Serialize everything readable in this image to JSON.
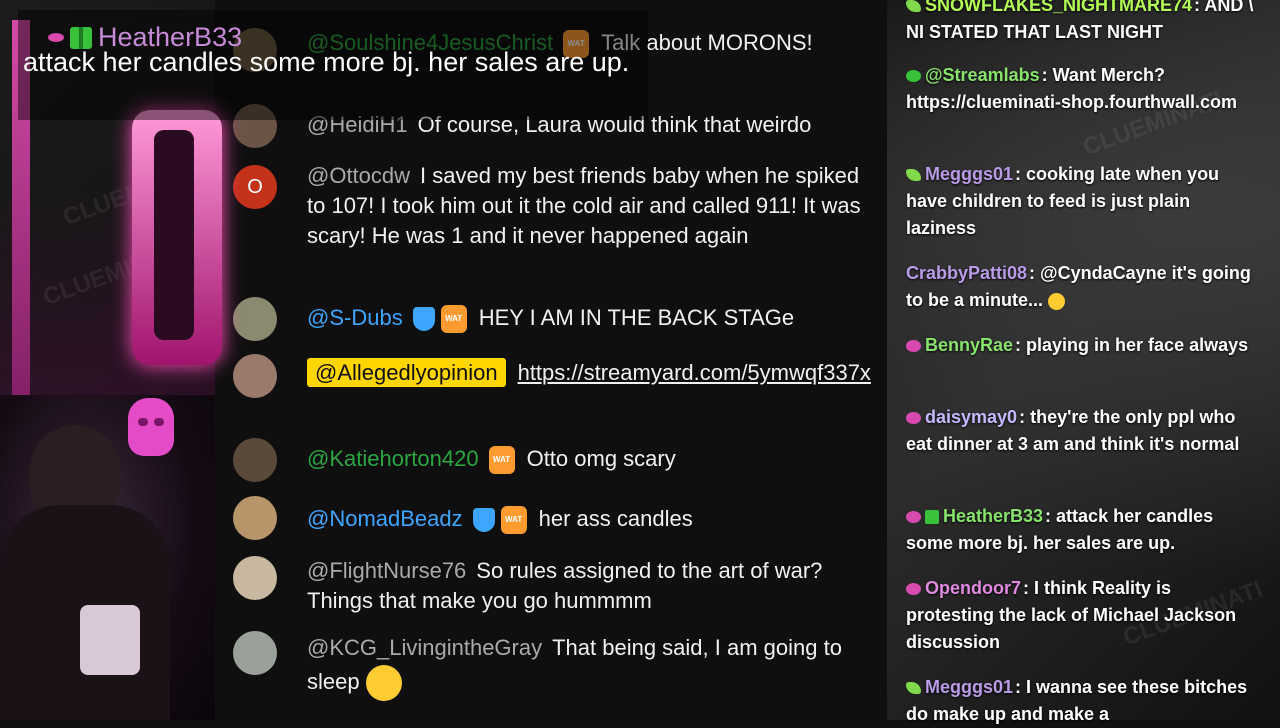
{
  "overlay": {
    "alert_user": "HeatherB33",
    "alert_message": "attack her candles some more bj. her sales are up.",
    "watermark": "CLUEMINATI"
  },
  "youtube_chat": {
    "messages": [
      {
        "author": "@Soulshine4JesusChrist",
        "text": "Talk about MORONS!",
        "author_color": "green",
        "badge": "wat"
      },
      {
        "author": "@HeidiH1",
        "text": "Of course, Laura would think that weirdo",
        "author_color": "gray"
      },
      {
        "author": "@Ottocdw",
        "text": "I saved my best friends baby when he spiked to 107! I took him out it the cold air and called 911! It was scary! He was 1 and it never happened again",
        "author_color": "gray",
        "avatar_letter": "O"
      },
      {
        "author": "@S-Dubs",
        "text": "HEY I AM IN THE BACK STAGe",
        "author_color": "blue",
        "badge": "shield+wat"
      },
      {
        "author": "@Allegedlyopinion",
        "text": "https://streamyard.com/5ymwqf337x",
        "author_color": "highlight"
      },
      {
        "author": "@Katiehorton420",
        "text": "Otto omg scary",
        "author_color": "green",
        "badge": "wat"
      },
      {
        "author": "@NomadBeadz",
        "text": "her ass candles",
        "author_color": "blue",
        "badge": "shield+wat"
      },
      {
        "author": "@FlightNurse76",
        "text": "So rules assigned to the art of war? Things that make you go hummmm",
        "author_color": "gray"
      },
      {
        "author": "@KCG_LivingintheGray",
        "text": "That being said, I am going to sleep",
        "author_color": "gray",
        "emoji": "sleeping-face"
      }
    ]
  },
  "twitch_chat": {
    "messages": [
      {
        "user": "SNOWFLAKES_NIGHTMARE74",
        "text": "AND \\ NI STATED THAT LAST NIGHT",
        "color": "lime",
        "icon": "leaf"
      },
      {
        "user": "@Streamlabs",
        "text": "Want Merch? https://clueminati-shop.fourthwall.com",
        "color": "green",
        "icon": "check"
      },
      {
        "user": "Megggs01",
        "text": "cooking late when you have children to feed is just plain laziness",
        "color": "purple",
        "icon": "leaf"
      },
      {
        "user": "CrabbyPatti08",
        "text": "@CyndaCayne it's going to be a minute...",
        "color": "purple",
        "icon": "none",
        "emoji": "laughing-face"
      },
      {
        "user": "BennyRae",
        "text": "playing in her face always",
        "color": "green",
        "icon": "eye"
      },
      {
        "user": "daisymay0",
        "text": "they're the only ppl who eat dinner at 3 am and think it's normal",
        "color": "lav",
        "icon": "eye"
      },
      {
        "user": "HeatherB33",
        "text": "attack her candles some more bj. her sales are up.",
        "color": "green",
        "icon": "eye+gift"
      },
      {
        "user": "Opendoor7",
        "text": "I think Reality is protesting the lack of Michael Jackson discussion",
        "color": "pink",
        "icon": "eye"
      },
      {
        "user": "Megggs01",
        "text": "I wanna see these bitches do make up and make a",
        "color": "purple",
        "icon": "leaf"
      }
    ]
  },
  "colors": {
    "yt_background": "#0f0f0f",
    "highlight_yellow": "#ffd600",
    "accent_pink": "#d84ab0"
  }
}
